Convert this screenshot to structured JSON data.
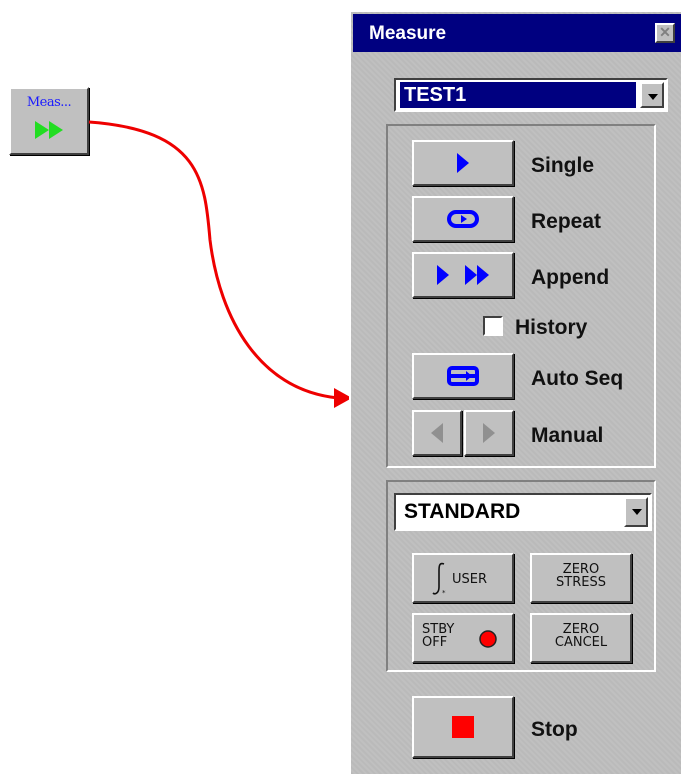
{
  "launcher": {
    "label": "Meas...",
    "icon": "fast-forward-icon"
  },
  "panel": {
    "title": "Measure",
    "test_select": {
      "value": "TEST1"
    },
    "modes": {
      "single_label": "Single",
      "repeat_label": "Repeat",
      "append_label": "Append",
      "history_label": "History",
      "history_checked": false,
      "autoseq_label": "Auto Seq",
      "manual_label": "Manual"
    },
    "setup_select": {
      "value": "STANDARD"
    },
    "controls": {
      "user_label": "USER",
      "zero_stress_line1": "ZERO",
      "zero_stress_line2": "STRESS",
      "stby_line1": "STBY",
      "stby_line2": "OFF",
      "zero_cancel_line1": "ZERO",
      "zero_cancel_line2": "CANCEL"
    },
    "stop_label": "Stop"
  },
  "colors": {
    "titlebar": "#000080",
    "icon_blue": "#0000ff",
    "launcher_arrows": "#22dd22",
    "connector": "#ee0000",
    "stop_square": "#ff0000"
  }
}
